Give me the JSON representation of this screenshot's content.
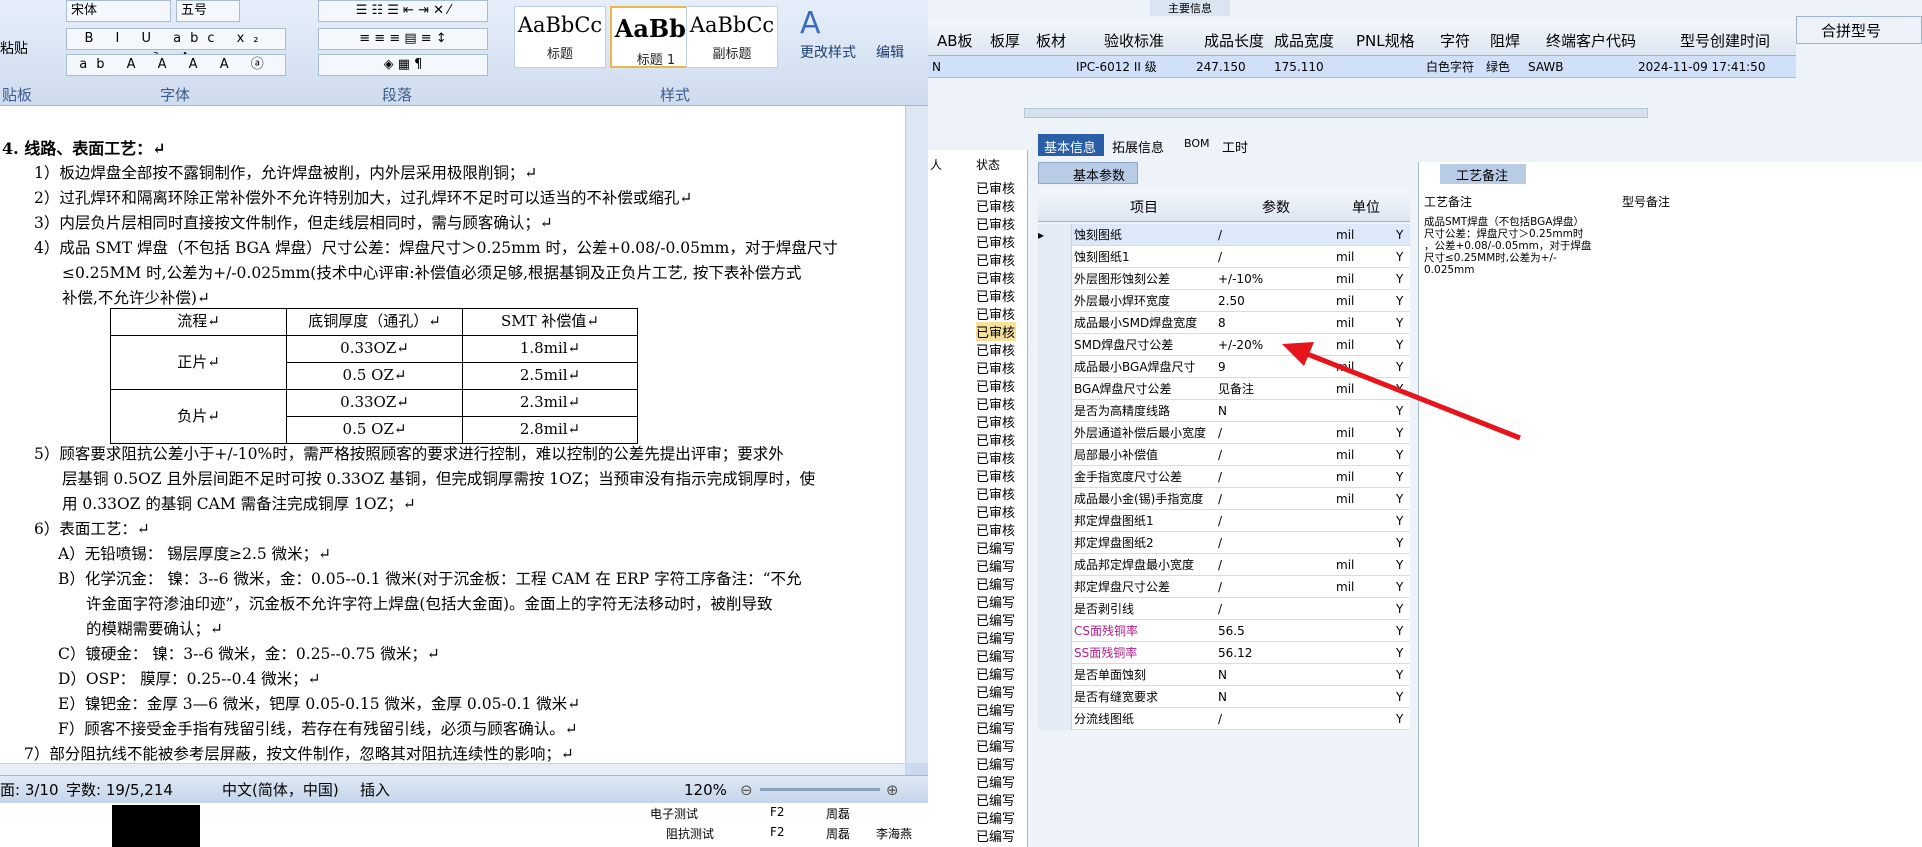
{
  "ribbon": {
    "font_name": "宋体",
    "font_size": "五号",
    "groups": [
      "字体",
      "段落",
      "样式"
    ],
    "clipboard_label": "贴板",
    "paste_label": "粘贴",
    "styles": [
      {
        "sample": "AaBbCc",
        "name": "标题"
      },
      {
        "sample": "AaBb(",
        "name": "标题 1"
      },
      {
        "sample": "AaBbCc",
        "name": "副标题"
      }
    ],
    "change_styles": "更改样式",
    "edit": "编辑"
  },
  "doc": {
    "heading": "4.  线路、表面工艺：↵",
    "lines": [
      "1）板边焊盘全部按不露铜制作，允许焊盘被削，内外层采用极限削铜；↵",
      "2）过孔焊环和隔离环除正常补偿外不允许特别加大，过孔焊环不足时可以适当的不补偿或缩孔↵",
      "3）内层负片层相同时直接按文件制作，但走线层相同时，需与顾客确认；↵",
      "4）成品 SMT 焊盘（不包括 BGA 焊盘）尺寸公差：焊盘尺寸＞0.25mm 时，公差+0.08/-0.05mm，对于焊盘尺寸",
      "≤0.25MM 时,公差为+/-0.025mm(技术中心评审:补偿值必须足够,根据基铜及正负片工艺, 按下表补偿方式",
      "补偿,不允许少补偿)↵"
    ],
    "table_header": [
      "流程↵",
      "底铜厚度（通孔）↵",
      "SMT 补偿值↵"
    ],
    "table_rows": [
      [
        "正片↵",
        "0.33OZ↵",
        "1.8mil↵"
      ],
      [
        "",
        "0.5 OZ↵",
        "2.5mil↵"
      ],
      [
        "负片↵",
        "0.33OZ↵",
        "2.3mil↵"
      ],
      [
        "",
        "0.5 OZ↵",
        "2.8mil↵"
      ]
    ],
    "lines2": [
      "5）顾客要求阻抗公差小于+/-10%时，需严格按照顾客的要求进行控制，难以控制的公差先提出评审；要求外",
      "层基铜 0.5OZ 且外层间距不足时可按 0.33OZ 基铜，但完成铜厚需按 1OZ；当预审没有指示完成铜厚时，使",
      "用 0.33OZ 的基铜 CAM 需备注完成铜厚 1OZ；↵",
      "6）表面工艺：↵",
      "A）无铅喷锡：  锡层厚度≥2.5 微米；↵",
      "B）化学沉金：  镍：3--6 微米，金：0.05--0.1 微米(对于沉金板：工程 CAM 在 ERP 字符工序备注：“不允",
      "许金面字符渗油印迹”，沉金板不允许字符上焊盘(包括大金面)。金面上的字符无法移动时，被削导致",
      "的模糊需要确认；↵",
      "C）镀硬金：     镍：3--6 微米，金：0.25--0.75 微米；↵",
      "D）OSP：        膜厚：0.25--0.4 微米；↵",
      "E）镍钯金：金厚 3—6 微米，钯厚 0.05-0.15 微米，金厚 0.05-0.1 微米↵",
      "F）顾客不接受金手指有残留引线，若存在有残留引线，必须与顾客确认。↵",
      "7）部分阻抗线不能被参考层屏蔽，按文件制作，忽略其对阻抗连续性的影响；↵"
    ]
  },
  "status": {
    "page": "面: 3/10",
    "words": "字数: 19/5,214",
    "lang": "中文(简体，中国)",
    "mode": "插入",
    "zoom": "120%"
  },
  "grid": {
    "top_label": "主要信息",
    "headers": [
      "AB板",
      "板厚",
      "板材",
      "验收标准",
      "成品长度",
      "成品宽度",
      "PNL规格",
      "字符",
      "阻焊",
      "终端客户代码",
      "型号创建时间",
      "合拼型号"
    ],
    "row": [
      "N",
      "",
      "",
      "IPC-6012 II 级",
      "247.150",
      "175.110",
      "",
      "白色字符",
      "绿色",
      "SAWB",
      "2024-11-09 17:41:50"
    ]
  },
  "tabs": [
    "基本信息",
    "拓展信息",
    "BOM",
    "工时"
  ],
  "basic": {
    "title": "基本参数",
    "headers": [
      "项目",
      "参数",
      "单位"
    ],
    "rows": [
      [
        "蚀刻图纸",
        "/",
        "mil",
        "Y"
      ],
      [
        "蚀刻图纸1",
        "/",
        "mil",
        "Y"
      ],
      [
        "外层图形蚀刻公差",
        "+/-10%",
        "mil",
        "Y"
      ],
      [
        "外层最小焊环宽度",
        "2.50",
        "mil",
        "Y"
      ],
      [
        "成品最小SMD焊盘宽度",
        "8",
        "mil",
        "Y"
      ],
      [
        "SMD焊盘尺寸公差",
        "+/-20%",
        "mil",
        "Y"
      ],
      [
        "成品最小BGA焊盘尺寸",
        "9",
        "mil",
        "Y"
      ],
      [
        "BGA焊盘尺寸公差",
        "见备注",
        "mil",
        "Y"
      ],
      [
        "是否为高精度线路",
        "N",
        "",
        "Y"
      ],
      [
        "外层通道补偿后最小宽度",
        "/",
        "mil",
        "Y"
      ],
      [
        "局部最小补偿值",
        "/",
        "mil",
        "Y"
      ],
      [
        "金手指宽度尺寸公差",
        "/",
        "mil",
        "Y"
      ],
      [
        "成品最小金(锡)手指宽度",
        "/",
        "mil",
        "Y"
      ],
      [
        "邦定焊盘图纸1",
        "/",
        "",
        "Y"
      ],
      [
        "邦定焊盘图纸2",
        "/",
        "",
        "Y"
      ],
      [
        "成品邦定焊盘最小宽度",
        "/",
        "mil",
        "Y"
      ],
      [
        "邦定焊盘尺寸公差",
        "/",
        "mil",
        "Y"
      ],
      [
        "是否剥引线",
        "/",
        "",
        "Y"
      ],
      [
        "CS面残铜率",
        "56.5",
        "",
        "Y"
      ],
      [
        "SS面残铜率",
        "56.12",
        "",
        "Y"
      ],
      [
        "是否单面蚀刻",
        "N",
        "",
        "Y"
      ],
      [
        "是否有缝宽要求",
        "N",
        "",
        "Y"
      ],
      [
        "分流线图纸",
        "/",
        "",
        "Y"
      ]
    ]
  },
  "craft": {
    "tab": "工艺备注",
    "col1": "工艺备注",
    "col2": "型号备注",
    "note": [
      "成品SMT焊盘（不包括BGA焊盘）",
      "尺寸公差：焊盘尺寸＞0.25mm时",
      "，公差+0.08/-0.05mm，对于焊盘",
      "尺寸≤0.25MM时,公差为+/-",
      "0.025mm"
    ]
  },
  "left_list": {
    "header": [
      "人",
      "状态"
    ],
    "status_values": [
      "已审核",
      "已审核",
      "已审核",
      "已审核",
      "已审核",
      "已审核",
      "已审核",
      "已审核",
      "已审核",
      "已审核",
      "已审核",
      "已审核",
      "已审核",
      "已审核",
      "已审核",
      "已审核",
      "已审核",
      "已审核",
      "已审核",
      "已审核",
      "已编写",
      "已编写",
      "已编写",
      "已编写",
      "已编写",
      "已编写",
      "已编写",
      "已编写",
      "已编写",
      "已编写",
      "已编写",
      "已编写",
      "已编写",
      "已编写",
      "已编写",
      "已编写",
      "已编写"
    ]
  },
  "tree": {
    "items": [
      {
        "name": "电子测试",
        "code": "F2",
        "user": "周磊",
        "extra": ""
      },
      {
        "name": "阻抗测试",
        "code": "F2",
        "user": "周磊",
        "extra": "李海燕"
      }
    ]
  },
  "colors": {
    "accent": "#2a5fa8",
    "arrow": "#e8141c",
    "selection": "#cfe0f8"
  }
}
